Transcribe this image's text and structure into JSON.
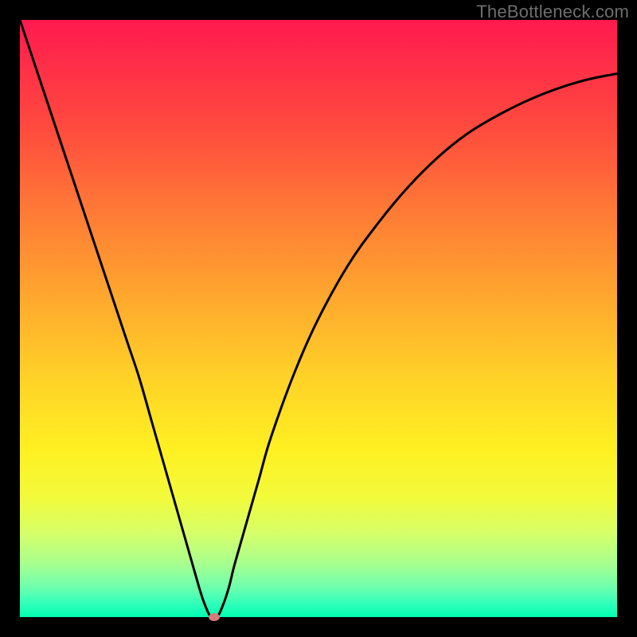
{
  "watermark": "TheBottleneck.com",
  "colors": {
    "frame": "#000000",
    "gradient_top": "#ff1a4f",
    "gradient_bottom": "#00ffb0",
    "curve": "#000000",
    "marker": "#d67a7a"
  },
  "chart_data": {
    "type": "line",
    "title": "",
    "xlabel": "",
    "ylabel": "",
    "xlim": [
      0,
      100
    ],
    "ylim": [
      0,
      100
    ],
    "grid": false,
    "legend": false,
    "series": [
      {
        "name": "bottleneck-curve",
        "x": [
          0,
          2,
          4,
          6,
          8,
          10,
          12,
          14,
          16,
          18,
          20,
          22,
          24,
          26,
          28,
          30,
          31,
          32,
          33,
          34,
          35,
          36,
          38,
          40,
          42,
          46,
          50,
          55,
          60,
          65,
          70,
          75,
          80,
          85,
          90,
          95,
          100
        ],
        "y": [
          100,
          94,
          88,
          82,
          76,
          70,
          64,
          58,
          52,
          46,
          40,
          33,
          26,
          19,
          12,
          5,
          2,
          0,
          0,
          2,
          5,
          9,
          16,
          23,
          30,
          41,
          50,
          59,
          66,
          72,
          77,
          81,
          84,
          86.5,
          88.5,
          90,
          91
        ]
      }
    ],
    "annotations": [
      {
        "name": "min-marker",
        "x": 32.5,
        "y": 0
      }
    ]
  }
}
